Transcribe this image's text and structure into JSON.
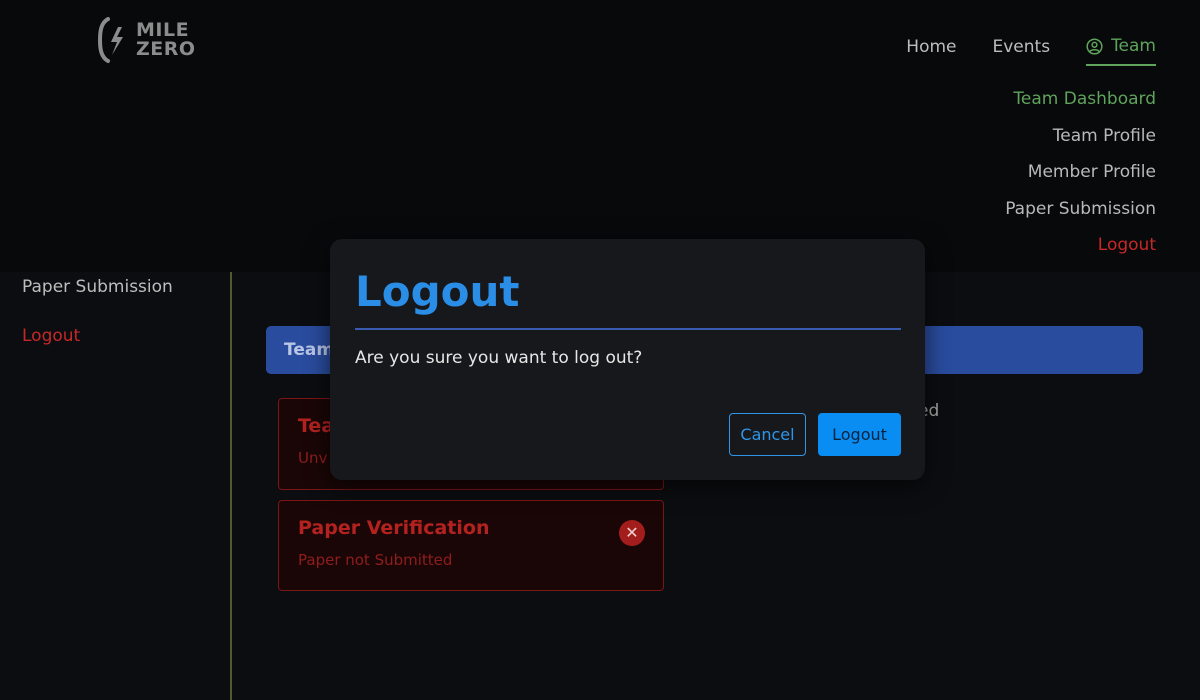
{
  "brand": {
    "logo_line1": "MILE",
    "logo_line2": "ZERO"
  },
  "nav": {
    "home": "Home",
    "events": "Events",
    "team": "Team"
  },
  "dropdown": [
    "Team Dashboard",
    "Team Profile",
    "Member Profile",
    "Paper Submission",
    "Logout"
  ],
  "sidebar": {
    "items": [
      "Paper Submission",
      "Logout"
    ]
  },
  "main": {
    "team_bar_label": "Team",
    "right_fragment": "ed",
    "cards": [
      {
        "title": "Tea",
        "subtitle": "Unv"
      },
      {
        "title": "Paper Verification",
        "subtitle": "Paper not Submitted"
      }
    ]
  },
  "dialog": {
    "title": "Logout",
    "message": "Are you sure you want to log out?",
    "cancel_label": "Cancel",
    "confirm_label": "Logout"
  },
  "icons": {
    "team": "user-circle-icon",
    "card_status": "close-circle-icon"
  },
  "colors": {
    "accent_green": "#5fa35c",
    "danger": "#c62828",
    "primary_blue": "#0a8df2",
    "bar_blue": "#2a4c9e"
  }
}
